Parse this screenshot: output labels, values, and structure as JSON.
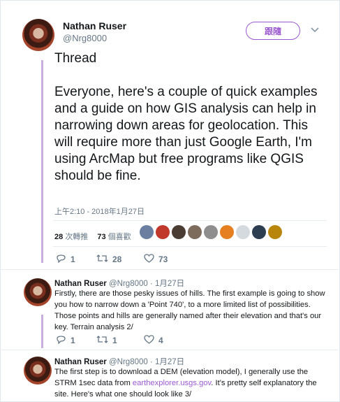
{
  "tweet": {
    "author_name": "Nathan Ruser",
    "author_handle": "@Nrg8000",
    "follow_label": "跟隨",
    "text_line1": "Thread",
    "text_para": "Everyone, here's a couple of quick examples and a guide on how GIS analysis can help in narrowing down areas for geolocation. This will require more than just Google Earth, I'm using ArcMap but free programs like QGIS should be fine.",
    "timestamp": "上午2:10 - 2018年1月27日",
    "retweets_count": "28",
    "retweets_label": "次轉推",
    "likes_count": "73",
    "likes_label": "個喜歡",
    "reply_count": "1",
    "retweet_count": "28",
    "like_count": "73"
  },
  "replies": [
    {
      "author_name": "Nathan Ruser",
      "handle_date": "@Nrg8000 · 1月27日",
      "text": "Firstly, there are those pesky issues of hills. The first example is going to show you how to narrow down a 'Point 740', to a more limited list of possibilities. Those points and hills are generally named after their elevation and that's our key. Terrain analysis 2/",
      "reply_count": "1",
      "retweet_count": "1",
      "like_count": "4"
    },
    {
      "author_name": "Nathan Ruser",
      "handle_date": "@Nrg8000 · 1月27日",
      "text_before": "The first step is to download a DEM (elevation model), I generally use the STRM 1sec data from ",
      "link": "earthexplorer.usgs.gov",
      "text_after": ". It's pretty self explanatory the site. Here's what one should look like 3/"
    }
  ],
  "colors": {
    "accent": "#9b59d0",
    "muted": "#657786",
    "thread_line": "#c9aee0"
  },
  "icons": [
    "chevron-down-icon",
    "reply-icon",
    "retweet-icon",
    "like-icon"
  ]
}
